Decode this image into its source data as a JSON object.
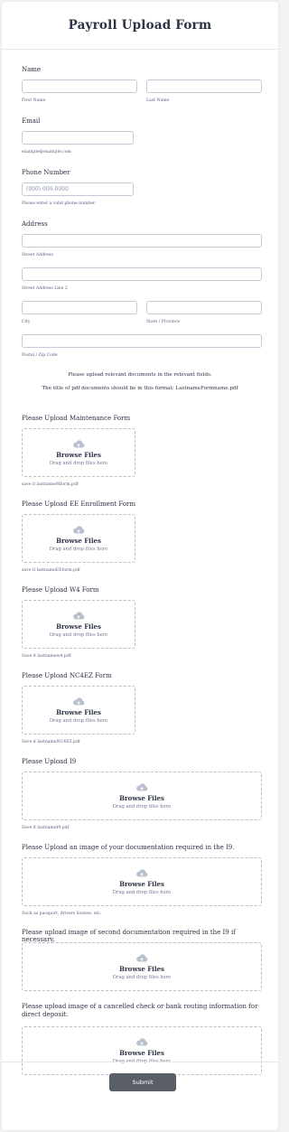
{
  "form": {
    "title": "Payroll Upload Form",
    "name": {
      "label": "Name",
      "first_sub": "First Name",
      "last_sub": "Last Name",
      "first_value": "",
      "last_value": ""
    },
    "email": {
      "label": "Email",
      "sub": "example@example.com",
      "value": ""
    },
    "phone": {
      "label": "Phone Number",
      "placeholder": "(000) 000-0000",
      "sub": "Please enter a valid phone number."
    },
    "address": {
      "label": "Address",
      "street_sub": "Street Address",
      "street2_sub": "Street Address Line 2",
      "city_sub": "City",
      "state_sub": "State / Province",
      "postal_sub": "Postal / Zip Code"
    },
    "note_line1": "Please upload relevant documents in the relevant fields.",
    "note_line2": "The title of pdf documents should be in this format: LastnameFormname.pdf",
    "browse_label": "Browse Files",
    "drag_label": "Drag and drop files here",
    "uploads": [
      {
        "label": "Please Upload Maintenance Form",
        "hint": "save it lastnameMform.pdf"
      },
      {
        "label": "Please Upload EE Enrollment Form",
        "hint": "save it lastnameEEform.pdf"
      },
      {
        "label": "Please Upload W4 Form",
        "hint": "Save it lastnamew4.pdf"
      },
      {
        "label": "Please Upload NC4EZ Form",
        "hint": "Save it lastnameNC4EZ.pdf"
      },
      {
        "label": "Please Upload I9",
        "hint": "Save it lastnameI9.pdf"
      },
      {
        "label": "Please Upload an image of your documentation required in the I9.",
        "hint": "Such as passport, drivers license, etc."
      },
      {
        "label": "Please upload image of second documentation required in the I9 if necessary.",
        "hint": ""
      },
      {
        "label": "Please upload image of a cancelled check or bank routing information for direct deposit.",
        "hint": ""
      }
    ],
    "submit_label": "Submit"
  },
  "colors": {
    "text": "#2c3345",
    "border": "#c3cad8",
    "submit_bg": "#5a5e66",
    "icon": "#b9c1cf"
  },
  "icons": {
    "upload": "cloud-upload-icon"
  }
}
